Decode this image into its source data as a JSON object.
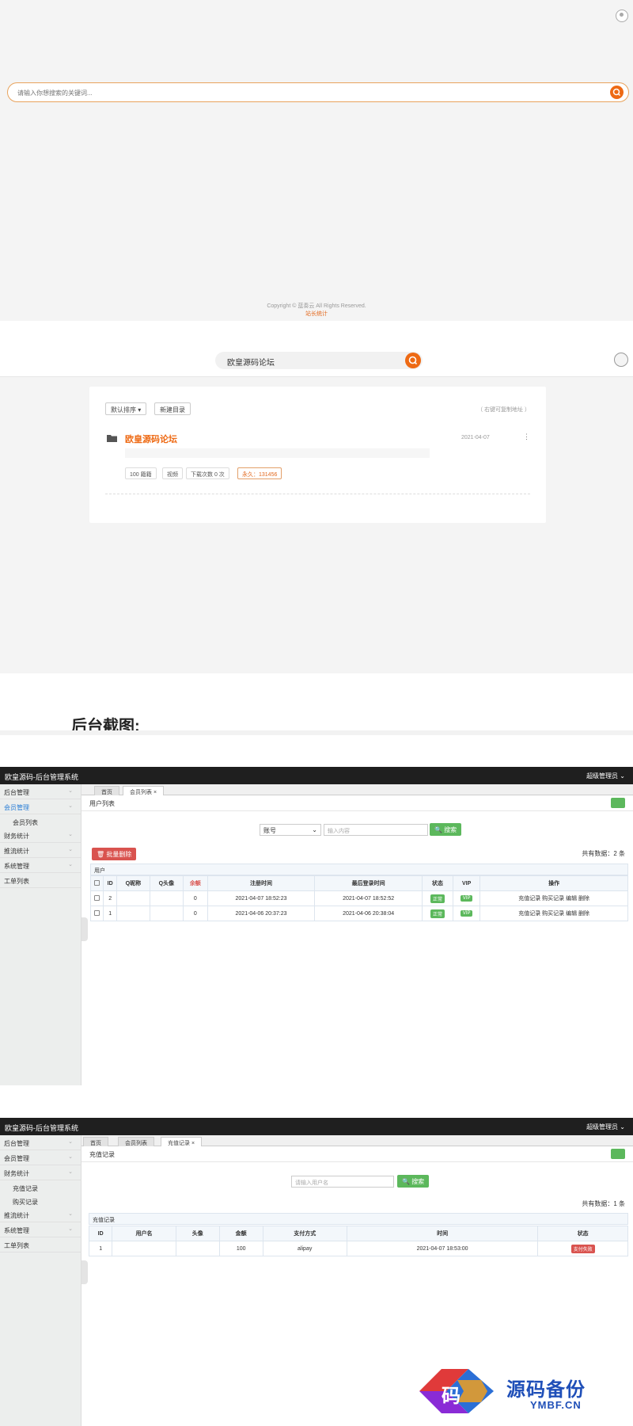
{
  "frontend_home": {
    "search_placeholder": "请输入你想搜索的关键词...",
    "copyright": "Copyright © 蓝奏云 All Rights Reserved.",
    "stats_link": "站长统计"
  },
  "frontend_list": {
    "search_value": "欧皇源码论坛",
    "sort_button": "默认排序 ▾",
    "new_dir_button": "新建目录",
    "hint": "（ 右键可复制地址 ）",
    "item": {
      "name": "欧皇源码论坛",
      "date": "2021-04-07",
      "tags": [
        "100 籍籍",
        "视频",
        "下载次数 0 次",
        "永久：131456"
      ]
    }
  },
  "section_heading": "后台截图:",
  "admin1": {
    "title": "欧皇源码-后台管理系统",
    "user": "超级管理员 ⌄",
    "sidebar": [
      {
        "label": "后台管理",
        "sub": false,
        "active": false
      },
      {
        "label": "会员管理",
        "sub": false,
        "active": true
      },
      {
        "label": "会员列表",
        "sub": true,
        "active": false
      },
      {
        "label": "财务统计",
        "sub": false,
        "active": false
      },
      {
        "label": "推流统计",
        "sub": false,
        "active": false
      },
      {
        "label": "系统管理",
        "sub": false,
        "active": false
      },
      {
        "label": "工单列表",
        "sub": false,
        "active": false
      }
    ],
    "tabs": [
      "首页",
      "会员列表"
    ],
    "crumb": "用户列表",
    "filter_select": "账号",
    "filter_placeholder": "输入内容",
    "search_button": "搜索",
    "batch_delete": "批量删除",
    "total": "共有数据：2 条",
    "caption": "用户",
    "columns": [
      "",
      "ID",
      "Q昵称",
      "Q头像",
      "余额",
      "注册时间",
      "最后登录时间",
      "状态",
      "VIP",
      "操作"
    ],
    "rows": [
      {
        "id": "2",
        "nick": "",
        "avatar": "",
        "balance": "0",
        "reg": "2021-04-07 18:52:23",
        "last": "2021-04-07 18:52:52",
        "status": "正常",
        "vip": "VIP",
        "ops": "充值记录 购买记录 编辑 删除"
      },
      {
        "id": "1",
        "nick": "",
        "avatar": "",
        "balance": "0",
        "reg": "2021-04-06 20:37:23",
        "last": "2021-04-06 20:38:04",
        "status": "正常",
        "vip": "VIP",
        "ops": "充值记录 购买记录 编辑 删除"
      }
    ]
  },
  "admin2": {
    "title": "欧皇源码-后台管理系统",
    "user": "超级管理员 ⌄",
    "sidebar": [
      {
        "label": "后台管理",
        "sub": false,
        "active": false
      },
      {
        "label": "会员管理",
        "sub": false,
        "active": false
      },
      {
        "label": "财务统计",
        "sub": false,
        "active": false
      },
      {
        "label": "充值记录",
        "sub": true,
        "active": false
      },
      {
        "label": "购买记录",
        "sub": true,
        "active": false
      },
      {
        "label": "推流统计",
        "sub": false,
        "active": false
      },
      {
        "label": "系统管理",
        "sub": false,
        "active": false
      },
      {
        "label": "工单列表",
        "sub": false,
        "active": false
      }
    ],
    "tabs": [
      "首页",
      "会员列表",
      "充值记录"
    ],
    "crumb": "充值记录",
    "filter_placeholder": "请输入用户名",
    "search_button": "搜索",
    "total": "共有数据：1 条",
    "caption": "充值记录",
    "columns": [
      "ID",
      "用户名",
      "头像",
      "金额",
      "支付方式",
      "时间",
      "状态"
    ],
    "rows": [
      {
        "id": "1",
        "user": "",
        "avatar": "",
        "amount": "100",
        "method": "alipay",
        "time": "2021-04-07 18:53:00",
        "status": "支付失败"
      }
    ]
  },
  "watermark": {
    "cn": "源码备份",
    "en": "YMBF.CN",
    "glyph": "码"
  },
  "colors": {
    "accent": "#ee6a14",
    "green": "#5cb85c",
    "red": "#d9534f",
    "topbar": "#1f1f1f"
  }
}
